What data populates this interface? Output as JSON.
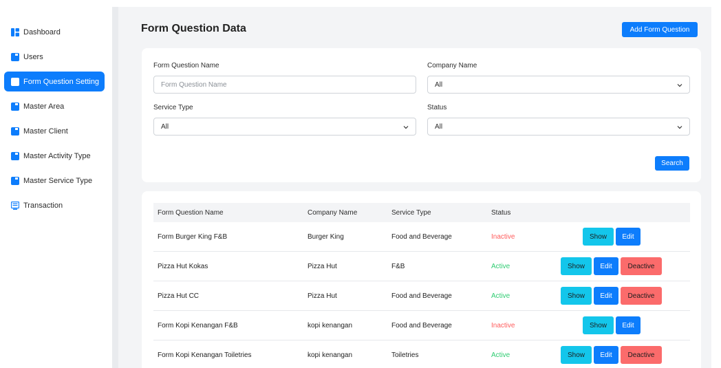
{
  "sidebar": {
    "items": [
      {
        "label": "Dashboard",
        "icon": "dashboard-icon",
        "active": false
      },
      {
        "label": "Users",
        "icon": "users-icon",
        "active": false
      },
      {
        "label": "Form Question Setting",
        "icon": "form-icon",
        "active": true
      },
      {
        "label": "Master Area",
        "icon": "area-icon",
        "active": false
      },
      {
        "label": "Master Client",
        "icon": "client-icon",
        "active": false
      },
      {
        "label": "Master Activity Type",
        "icon": "activity-icon",
        "active": false
      },
      {
        "label": "Master Service Type",
        "icon": "service-icon",
        "active": false
      },
      {
        "label": "Transaction",
        "icon": "transaction-icon",
        "active": false
      }
    ]
  },
  "header": {
    "title": "Form Question Data",
    "add_button_label": "Add Form Question"
  },
  "filters": {
    "form_question_name": {
      "label": "Form Question Name",
      "placeholder": "Form Question Name",
      "value": ""
    },
    "company_name": {
      "label": "Company Name",
      "value": "All"
    },
    "service_type": {
      "label": "Service Type",
      "value": "All"
    },
    "status": {
      "label": "Status",
      "value": "All"
    },
    "search_button_label": "Search"
  },
  "table": {
    "columns": [
      "Form Question Name",
      "Company Name",
      "Service Type",
      "Status"
    ],
    "rows": [
      {
        "name": "Form Burger King F&B",
        "company": "Burger King",
        "service": "Food and Beverage",
        "status": "Inactive"
      },
      {
        "name": "Pizza Hut Kokas",
        "company": "Pizza Hut",
        "service": "F&B",
        "status": "Active"
      },
      {
        "name": "Pizza Hut CC",
        "company": "Pizza Hut",
        "service": "Food and Beverage",
        "status": "Active"
      },
      {
        "name": "Form Kopi Kenangan F&B",
        "company": "kopi kenangan",
        "service": "Food and Beverage",
        "status": "Inactive"
      },
      {
        "name": "Form Kopi Kenangan Toiletries",
        "company": "kopi kenangan",
        "service": "Toiletries",
        "status": "Active"
      }
    ],
    "actions": {
      "show": "Show",
      "edit": "Edit",
      "deactive": "Deactive"
    }
  },
  "colors": {
    "primary": "#0d7dfc",
    "show": "#13c6eb",
    "deactive": "#fb6b6b",
    "active_text": "#2ecc71",
    "inactive_text": "#ff5b5b"
  }
}
